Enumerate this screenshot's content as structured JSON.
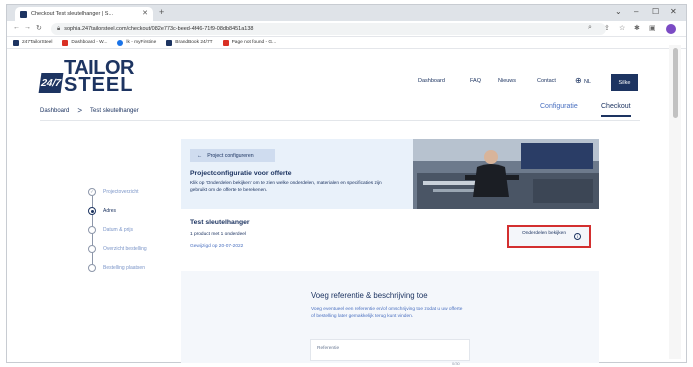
{
  "browser": {
    "tab_title": "Checkout Test sleutelhanger | S...",
    "url": "sophia.247tailorsteel.com/checkout/082e773c-beed-4f46-71f9-08db8451a138",
    "bookmarks": [
      "247TailorSteel",
      "Dashboard - W...",
      "lk - myFirstine",
      "BrandBook 24/7T",
      "Page not found - G..."
    ]
  },
  "header": {
    "logo_badge": "24/7",
    "logo_line1": "TAILOR",
    "logo_line2": "STEEL",
    "nav": [
      "Dashboard",
      "FAQ",
      "Nieuws",
      "Contact"
    ],
    "language": "NL",
    "user_button": "Silke"
  },
  "breadcrumb": {
    "home": "Dashboard",
    "separator": ">",
    "current": "Test sleutelhanger"
  },
  "section_tabs": {
    "configuratie": "Configuratie",
    "checkout": "Checkout"
  },
  "steps": [
    "Projectoverzicht",
    "Adres",
    "Datum & prijs",
    "Overzicht bestelling",
    "Bestelling plaatsen"
  ],
  "project_card": {
    "back_button": "Project configureren",
    "title": "Projectconfiguratie voor offerte",
    "description": "Klik op 'Onderdelen bekijken' om te zien welke onderdelen, materialen en specificaties zijn gebruikt om de offerte te berekenen."
  },
  "product_card": {
    "title": "Test sleutelhanger",
    "subtitle": "1 product met 1 onderdeel",
    "date": "Gewijzigd op 20-07-2022",
    "parts_button": "Onderdelen bekijken"
  },
  "reference_card": {
    "title": "Voeg referentie & beschrijving toe",
    "description": "Voeg eventueel een referentie en/of omschrijving toe zodat u uw offerte of bestelling later gemakkelijk terug kunt vinden.",
    "input_label": "Referentie",
    "counter": "0/30"
  },
  "colors": {
    "brand_navy": "#1d3461",
    "highlight_red": "#d32f2f",
    "link_blue": "#4a70c0"
  }
}
